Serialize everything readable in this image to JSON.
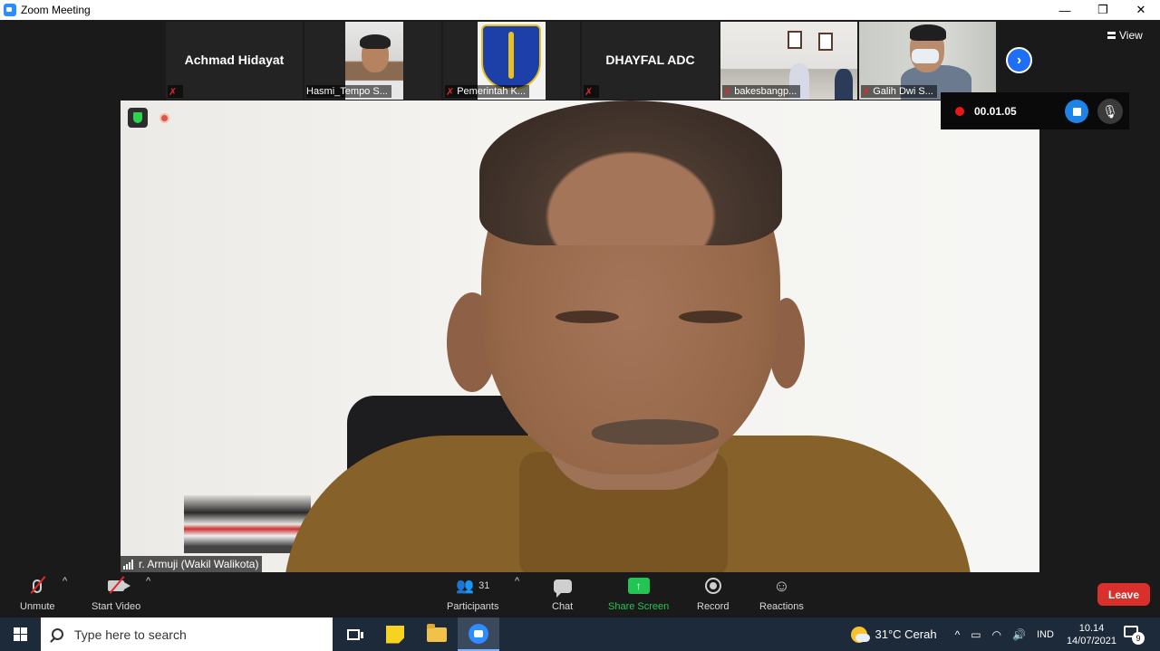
{
  "window": {
    "title": "Zoom Meeting",
    "min_glyph": "—",
    "restore_glyph": "❐",
    "close_glyph": "✕"
  },
  "thumbnails": [
    {
      "name": "Achmad Hidayat",
      "label": "",
      "muted": true
    },
    {
      "name": "",
      "label": "Hasmi_Tempo S...",
      "muted": false
    },
    {
      "name": "",
      "label": "Pemerintah K...",
      "muted": true
    },
    {
      "name": "DHAYFAL ADC",
      "label": "",
      "muted": true
    },
    {
      "name": "",
      "label": "bakesbangp...",
      "muted": true
    },
    {
      "name": "",
      "label": "Galih Dwi S...",
      "muted": true
    }
  ],
  "view_button": {
    "label": "View"
  },
  "recording": {
    "time": "00.01.05"
  },
  "main_speaker": {
    "name": "r. Armuji (Wakil Walikota)"
  },
  "controls": {
    "unmute": "Unmute",
    "start_video": "Start Video",
    "participants": "Participants",
    "participants_count": "31",
    "chat": "Chat",
    "share_screen": "Share Screen",
    "record": "Record",
    "reactions": "Reactions",
    "leave": "Leave"
  },
  "colors": {
    "leave": "#d9302b",
    "share": "#23c552",
    "accent": "#1e6ff5"
  },
  "taskbar": {
    "search_placeholder": "Type here to search",
    "weather": "31°C  Cerah",
    "language": "IND",
    "time": "10.14",
    "date": "14/07/2021",
    "notifications": "9"
  }
}
